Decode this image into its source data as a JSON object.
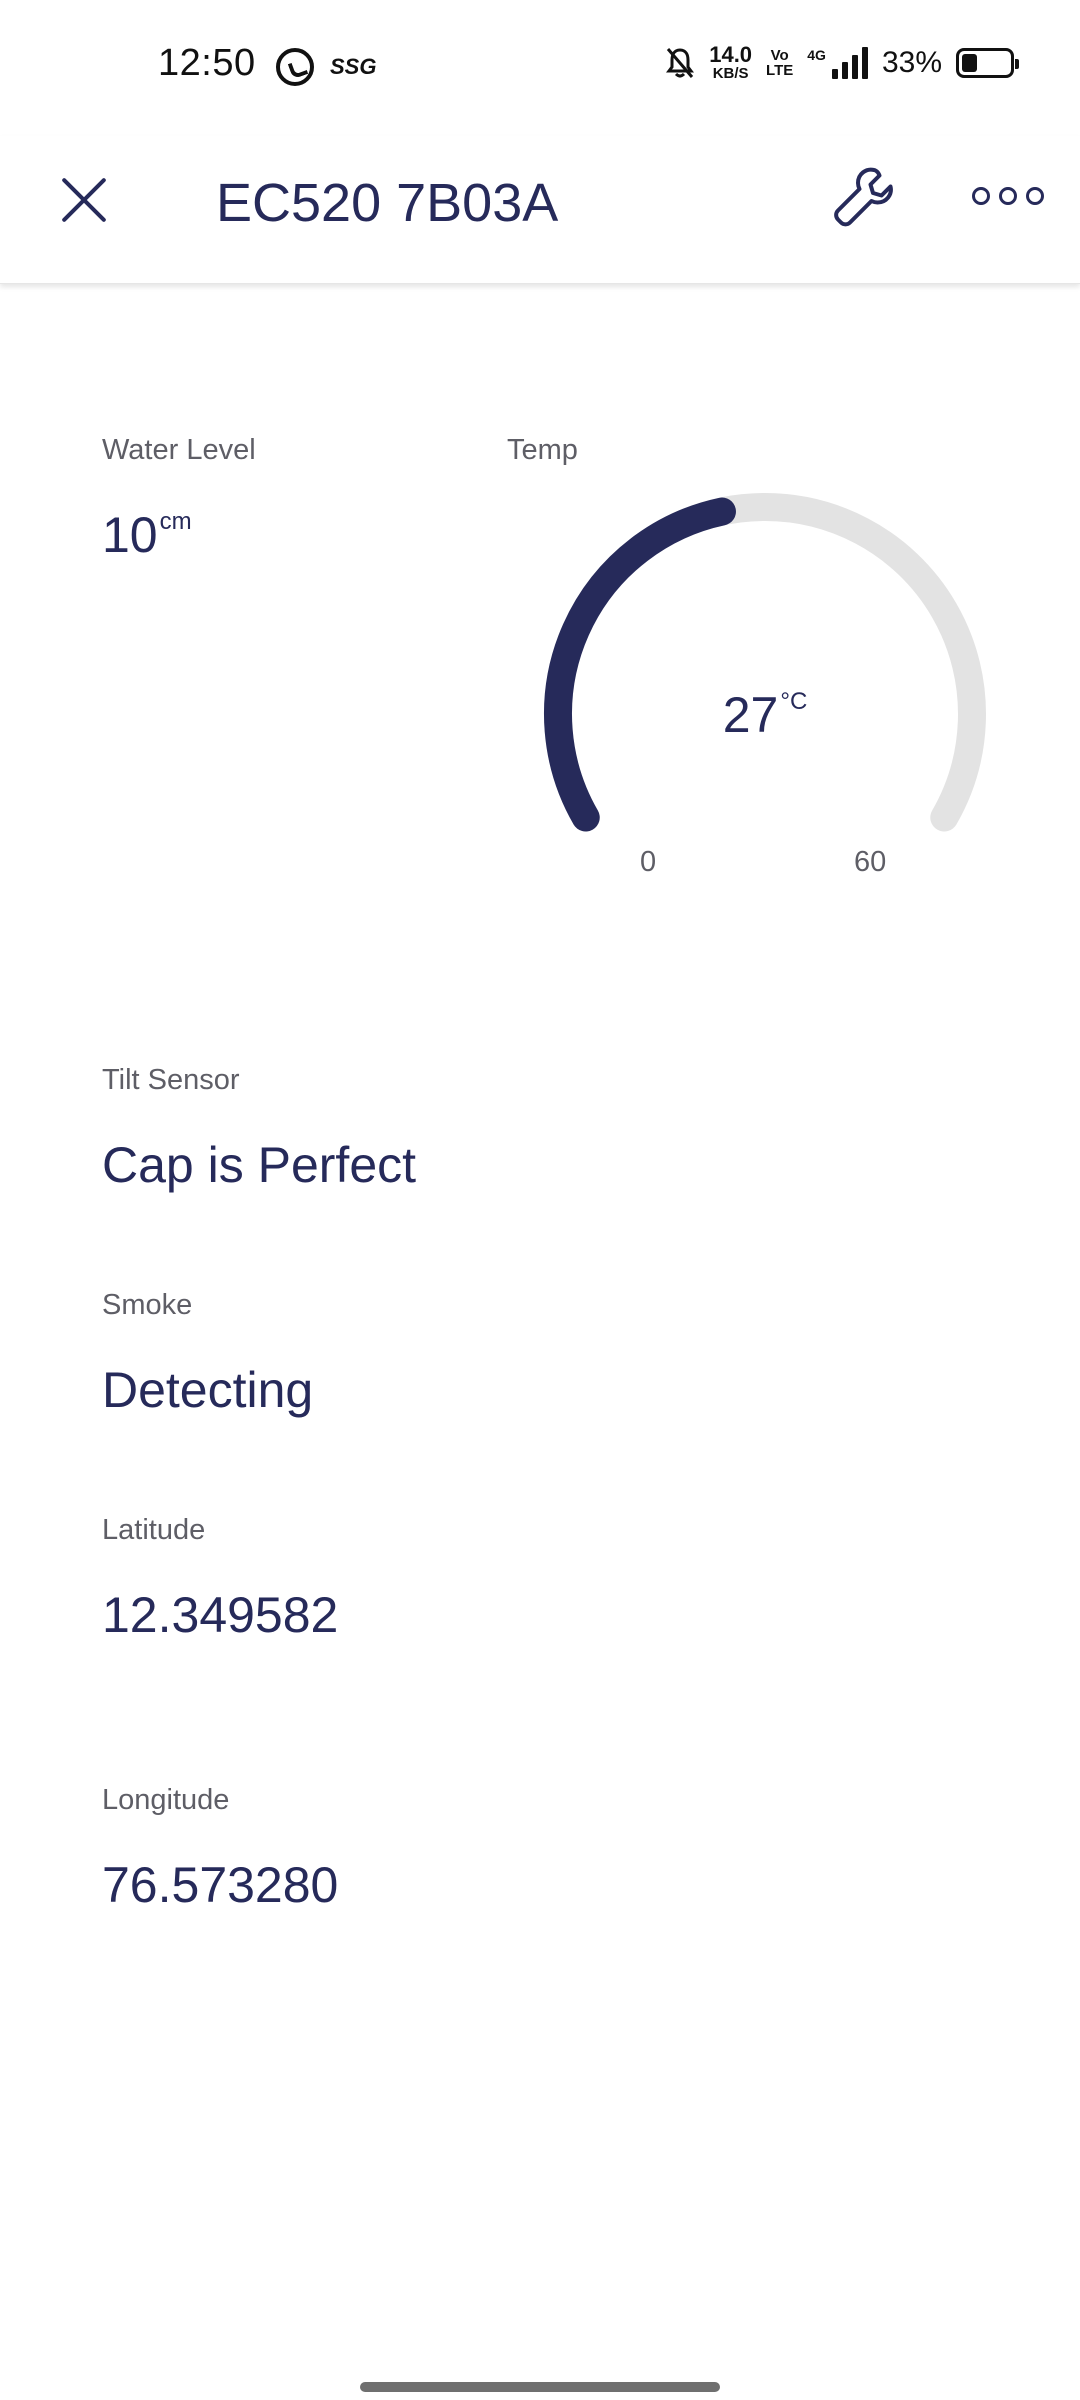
{
  "status_bar": {
    "time": "12:50",
    "net_speed_value": "14.0",
    "net_speed_unit": "KB/S",
    "volte_top": "Vo",
    "volte_bottom": "LTE",
    "network_type": "4G",
    "battery_percent": "33%",
    "battery_level": 0.33,
    "ssg_label": "SSG"
  },
  "header": {
    "title": "EC520 7B03A"
  },
  "water_level": {
    "label": "Water Level",
    "value": "10",
    "unit": "cm"
  },
  "temperature": {
    "label": "Temp",
    "value": "27",
    "unit": "°C",
    "min_label": "0",
    "max_label": "60",
    "min": 0,
    "max": 60,
    "current": 27
  },
  "tilt_sensor": {
    "label": "Tilt Sensor",
    "value": "Cap is Perfect"
  },
  "smoke": {
    "label": "Smoke",
    "value": "Detecting"
  },
  "latitude": {
    "label": "Latitude",
    "value": "12.349582"
  },
  "longitude": {
    "label": "Longitude",
    "value": "76.573280"
  },
  "colors": {
    "accent": "#262a5a",
    "gauge_track": "#e3e3e3",
    "label": "#5e5e66"
  }
}
